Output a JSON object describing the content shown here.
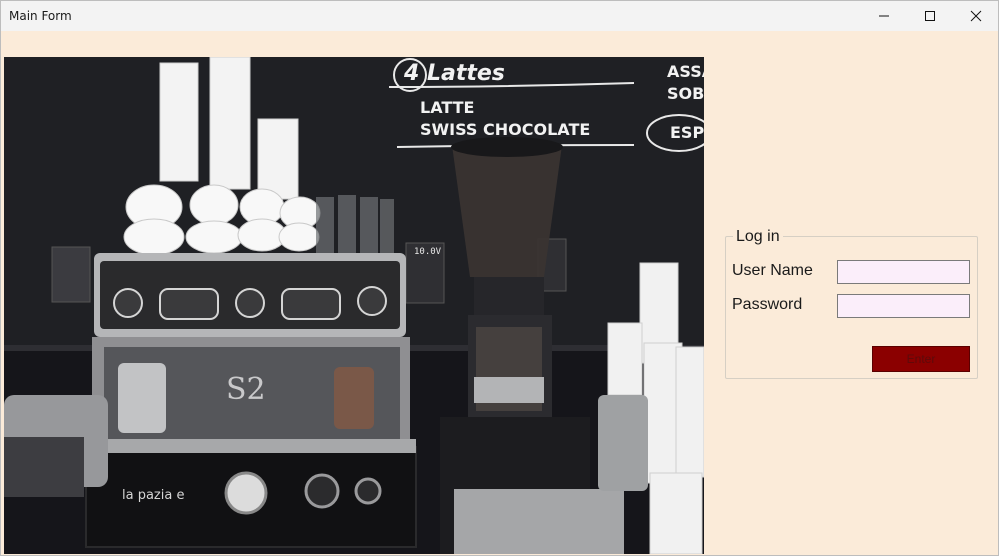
{
  "window": {
    "title": "Main Form",
    "background": "#fbebd9"
  },
  "photo": {
    "chalkboard": {
      "line1": "4 Lattes",
      "line2": "LATTE",
      "line3": "SWISS CHOCOLATE",
      "right1": "ASSA",
      "right2": "SOBR",
      "right3": "ESPE"
    },
    "machine_badge": "S2",
    "machine_brand": "la pazia e",
    "grinder_display": "10.0V"
  },
  "login": {
    "group_title": "Log in",
    "username_label": "User Name",
    "username_value": "",
    "password_label": "Password",
    "password_value": "",
    "enter_label": "Enter",
    "enter_color": "#8b0000",
    "field_bg": "#fbeefa"
  }
}
